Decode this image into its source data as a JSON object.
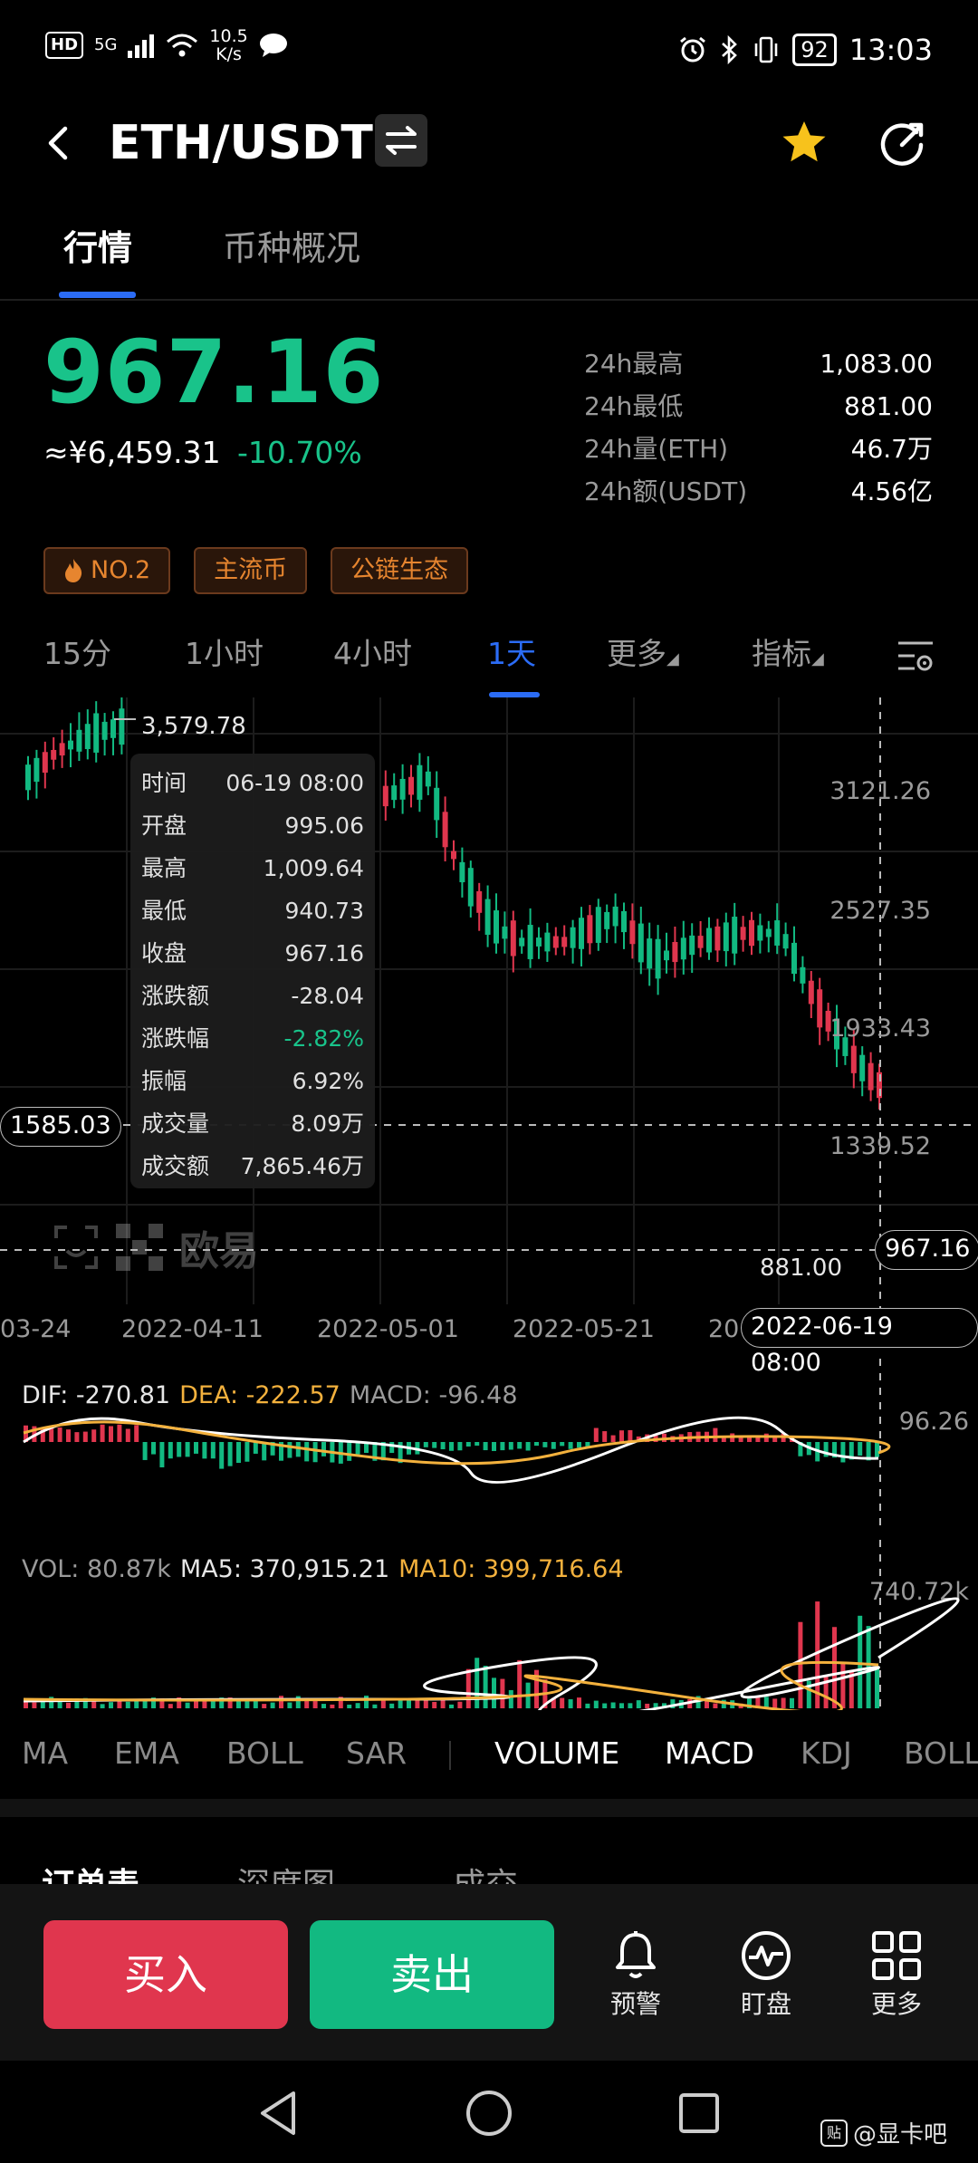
{
  "status_bar": {
    "hd": "HD",
    "network": "5G",
    "speed": "10.5",
    "speed_unit": "K/s",
    "battery": "92",
    "time": "13:03"
  },
  "header": {
    "pair": "ETH/USDT"
  },
  "tabs": [
    {
      "label": "行情",
      "active": true
    },
    {
      "label": "币种概况",
      "active": false
    }
  ],
  "price": {
    "last": "967.16",
    "cny": "≈¥6,459.31",
    "change_pct": "-10.70%"
  },
  "stats": [
    {
      "label": "24h最高",
      "value": "1,083.00"
    },
    {
      "label": "24h最低",
      "value": "881.00"
    },
    {
      "label": "24h量(ETH)",
      "value": "46.7万"
    },
    {
      "label": "24h额(USDT)",
      "value": "4.56亿"
    }
  ],
  "tags": [
    {
      "label": "NO.2",
      "icon": "fire-icon"
    },
    {
      "label": "主流币"
    },
    {
      "label": "公链生态"
    }
  ],
  "periods": [
    {
      "label": "15分"
    },
    {
      "label": "1小时"
    },
    {
      "label": "4小时"
    },
    {
      "label": "1天",
      "active": true
    },
    {
      "label": "更多"
    },
    {
      "label": "指标"
    }
  ],
  "kline": {
    "y_ticks": [
      "3121.26",
      "2527.35",
      "1933.43",
      "1339.52"
    ],
    "x_ticks": [
      "03-24",
      "2022-04-11",
      "2022-05-01",
      "2022-05-21",
      "20"
    ],
    "max_label": "3,579.78",
    "min_label": "881.00",
    "crosshair_price": "1585.03",
    "last_price_flag": "967.16",
    "crosshair_time": "2022-06-19 08:00",
    "watermark": "欧易"
  },
  "tooltip": [
    {
      "label": "时间",
      "value": "06-19 08:00"
    },
    {
      "label": "开盘",
      "value": "995.06"
    },
    {
      "label": "最高",
      "value": "1,009.64"
    },
    {
      "label": "最低",
      "value": "940.73"
    },
    {
      "label": "收盘",
      "value": "967.16"
    },
    {
      "label": "涨跌额",
      "value": "-28.04"
    },
    {
      "label": "涨跌幅",
      "value": "-2.82%",
      "green": true
    },
    {
      "label": "振幅",
      "value": "6.92%"
    },
    {
      "label": "成交量",
      "value": "8.09万"
    },
    {
      "label": "成交额",
      "value": "7,865.46万"
    }
  ],
  "macd": {
    "dif": "DIF: -270.81",
    "dea": "DEA: -222.57",
    "macd": "MACD: -96.48",
    "y_tick": "96.26"
  },
  "volume": {
    "vol": "VOL: 80.87k",
    "ma5": "MA5: 370,915.21",
    "ma10": "MA10: 399,716.64",
    "y_tick": "740.72k"
  },
  "indicators": [
    {
      "label": "MA"
    },
    {
      "label": "EMA"
    },
    {
      "label": "BOLL"
    },
    {
      "label": "SAR"
    },
    {
      "label": "VOLUME",
      "active": true
    },
    {
      "label": "MACD",
      "active": true
    },
    {
      "label": "KDJ"
    },
    {
      "label": "BOLL"
    }
  ],
  "lower_tabs": [
    {
      "label": "订单表"
    },
    {
      "label": "深度图"
    },
    {
      "label": "成交"
    }
  ],
  "actions": {
    "buy": "买入",
    "sell": "卖出",
    "alert": "预警",
    "watch": "盯盘",
    "more": "更多"
  },
  "watermark2": "@显卡吧",
  "colors": {
    "up": "#e0364e",
    "down": "#12b981",
    "accent": "#2b6cf6",
    "tag": "#e6852f"
  }
}
